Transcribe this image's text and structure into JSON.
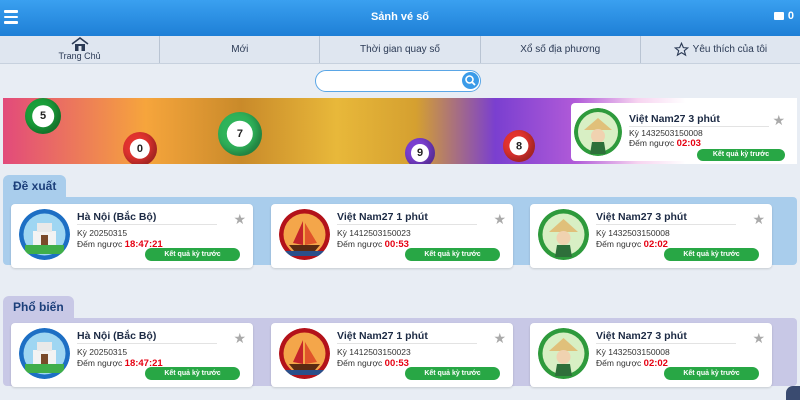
{
  "header": {
    "title": "Sảnh vé số",
    "balance": "0"
  },
  "nav": {
    "items": [
      "Trang Chủ",
      "Mới",
      "Thời gian quay số",
      "Xổ số địa phương",
      "Yêu thích của tôi"
    ]
  },
  "search": {
    "placeholder": ""
  },
  "banner": {
    "balls": [
      "5",
      "0",
      "7",
      "9",
      "8"
    ],
    "featured": {
      "name": "Việt Nam27 3 phút",
      "ky": "Kỳ 1432503150008",
      "countdown_label": "Đếm ngược",
      "countdown": "02:03",
      "button": "Kết quả kỳ trước"
    }
  },
  "sections": [
    {
      "title": "Đề xuất",
      "cards": [
        {
          "name": "Hà Nội (Bắc Bộ)",
          "ky": "Kỳ 20250315",
          "countdown_label": "Đếm ngược",
          "countdown": "18:47:21",
          "button": "Kết quả kỳ trước"
        },
        {
          "name": "Việt Nam27 1 phút",
          "ky": "Kỳ 1412503150023",
          "countdown_label": "Đếm ngược",
          "countdown": "00:53",
          "button": "Kết quả kỳ trước"
        },
        {
          "name": "Việt Nam27 3 phút",
          "ky": "Kỳ 1432503150008",
          "countdown_label": "Đếm ngược",
          "countdown": "02:02",
          "button": "Kết quả kỳ trước"
        }
      ]
    },
    {
      "title": "Phổ biến",
      "cards": [
        {
          "name": "Hà Nội (Bắc Bộ)",
          "ky": "Kỳ 20250315",
          "countdown_label": "Đếm ngược",
          "countdown": "18:47:21",
          "button": "Kết quả kỳ trước"
        },
        {
          "name": "Việt Nam27 1 phút",
          "ky": "Kỳ 1412503150023",
          "countdown_label": "Đếm ngược",
          "countdown": "00:53",
          "button": "Kết quả kỳ trước"
        },
        {
          "name": "Việt Nam27 3 phút",
          "ky": "Kỳ 1432503150008",
          "countdown_label": "Đếm ngược",
          "countdown": "02:02",
          "button": "Kết quả kỳ trước"
        }
      ]
    }
  ],
  "colors": {
    "header": "#1e7fd6",
    "button_green": "#28a745",
    "countdown_red": "#e60012"
  }
}
